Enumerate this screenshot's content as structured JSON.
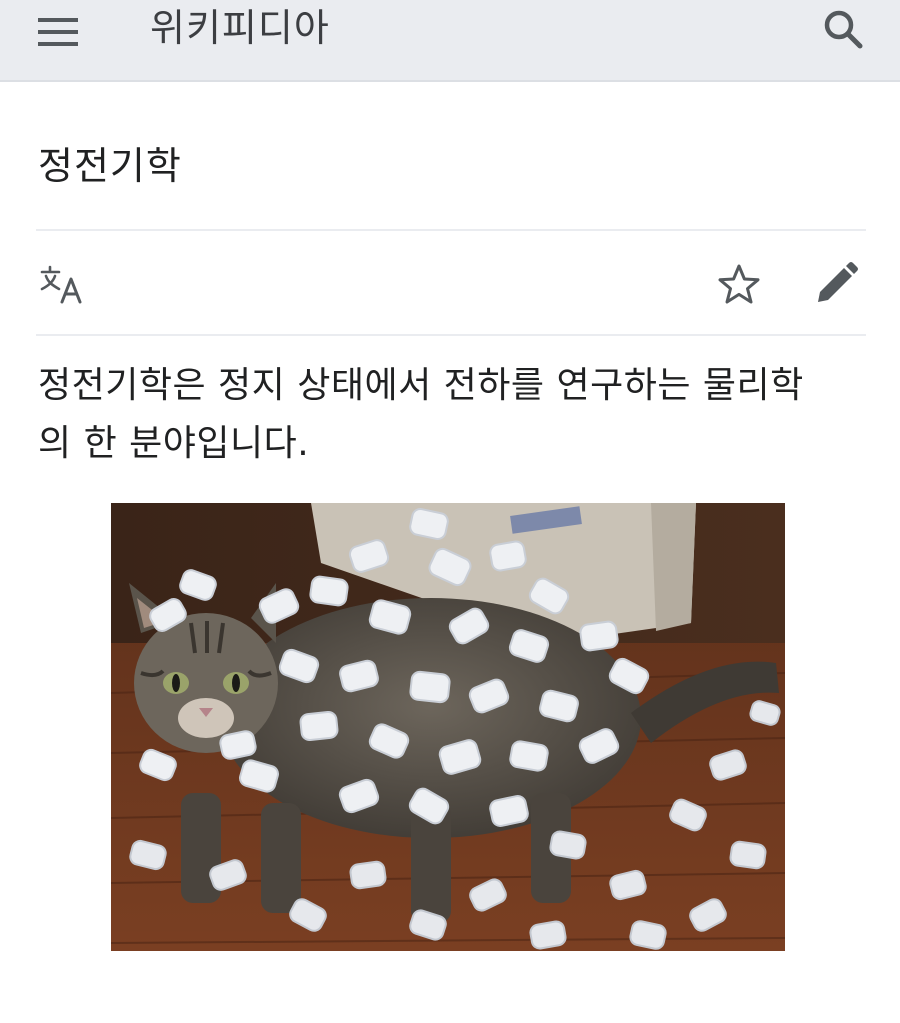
{
  "header": {
    "brand": "위키피디아",
    "menu_icon": "hamburger-menu-icon",
    "search_icon": "search-icon"
  },
  "article": {
    "title": "정전기학",
    "lead": "정전기학은 정지 상태에서 전하를 연구하는 물리학의 한 분야입니다."
  },
  "actions": {
    "language_icon": "language-icon",
    "watch_icon": "star-icon",
    "edit_icon": "pencil-icon"
  },
  "image": {
    "subject": "tabby-cat-covered-in-packing-peanuts"
  },
  "colors": {
    "header_bg": "#eaecf0",
    "text": "#202122",
    "icon": "#54595d",
    "divider": "#eaecf0"
  }
}
